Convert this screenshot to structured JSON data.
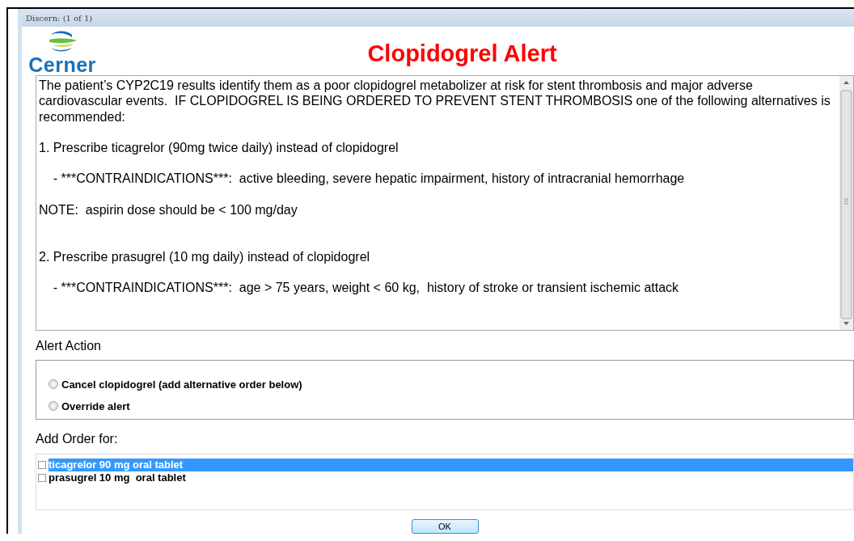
{
  "window": {
    "title": "Discern:  (1 of 1)"
  },
  "logo": {
    "text": "Cerner"
  },
  "alert": {
    "title": "Clopidogrel Alert",
    "message": "The patient’s CYP2C19 results identify them as a poor clopidogrel metabolizer at risk for stent thrombosis and major adverse cardiovascular events.  IF CLOPIDOGREL IS BEING ORDERED TO PREVENT STENT THROMBOSIS one of the following alternatives is recommended:\n\n1. Prescribe ticagrelor (90mg twice daily) instead of clopidogrel\n\n    - ***CONTRAINDICATIONS***:  active bleeding, severe hepatic impairment, history of intracranial hemorrhage\n\nNOTE:  aspirin dose should be < 100 mg/day\n\n\n2. Prescribe prasugrel (10 mg daily) instead of clopidogrel\n\n    - ***CONTRAINDICATIONS***:  age > 75 years, weight < 60 kg,  history of stroke or transient ischemic attack"
  },
  "alert_action": {
    "label": "Alert Action",
    "options": [
      {
        "label": "Cancel clopidogrel (add alternative order below)",
        "selected": false
      },
      {
        "label": "Override alert",
        "selected": false
      }
    ]
  },
  "add_order": {
    "label": "Add Order for:",
    "items": [
      {
        "label": "ticagrelor 90 mg oral tablet",
        "checked": false,
        "selected": true
      },
      {
        "label": "prasugrel 10 mg  oral tablet",
        "checked": false,
        "selected": false
      }
    ]
  },
  "buttons": [
    {
      "label": "OK"
    }
  ]
}
